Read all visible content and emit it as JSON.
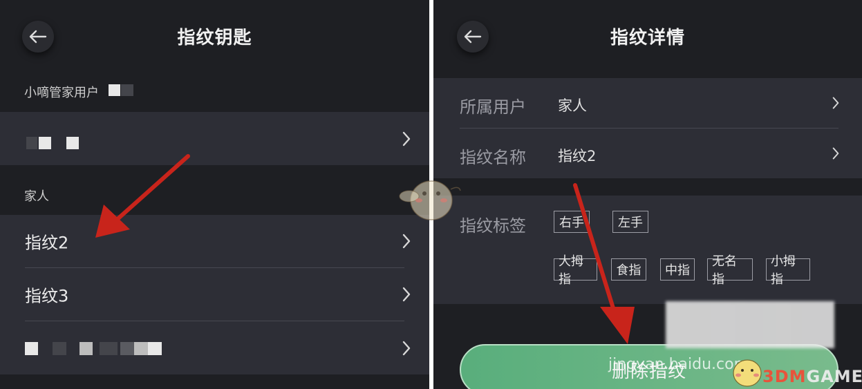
{
  "left": {
    "title": "指纹钥匙",
    "section1_label": "小嘀管家用户",
    "section2_label": "家人",
    "items": [
      {
        "label": "指纹2"
      },
      {
        "label": "指纹3"
      }
    ]
  },
  "right": {
    "title": "指纹详情",
    "fields": [
      {
        "label": "所属用户",
        "value": "家人"
      },
      {
        "label": "指纹名称",
        "value": "指纹2"
      }
    ],
    "tags_label": "指纹标签",
    "hand_tags": [
      "右手",
      "左手"
    ],
    "finger_tags": [
      "大拇指",
      "食指",
      "中指",
      "无名指",
      "小拇指"
    ],
    "delete_label": "删除指纹"
  },
  "watermark": {
    "site": "jingyan.baidu.com",
    "brand_prefix": "3DM",
    "brand_suffix": "GAME"
  },
  "colors": {
    "background": "#1e1f23",
    "row": "#2d2e36",
    "accent_green": "#59ae7c",
    "arrow_red": "#c8241b"
  }
}
